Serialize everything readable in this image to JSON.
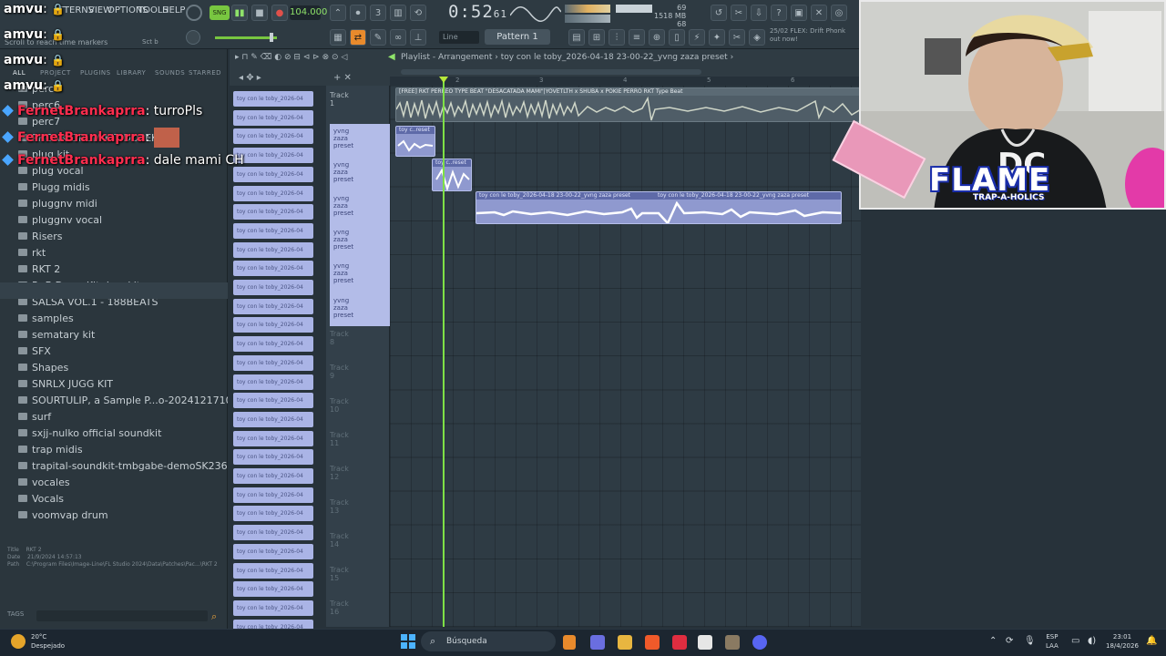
{
  "app": {
    "menu": [
      "TTERNS",
      "VIEW",
      "OPTIONS",
      "TOOLS",
      "HELP"
    ],
    "tempo": "104.000",
    "time": "0:52",
    "time_sub": "61",
    "cpu": "69",
    "memory": "1518 MB",
    "polyphony": "68",
    "pattern": "Pattern 1",
    "snap": "Line",
    "news_line1": "25/02  FLEX: Drift Phonk",
    "news_line2": "out now!",
    "hint": "Scroll to reach time markers",
    "hint_right": "Sct b"
  },
  "browser": {
    "tabs": [
      "ALL",
      "PROJECT",
      "PLUGINS",
      "LIBRARY",
      "SOUNDS",
      "STARRED"
    ],
    "items": [
      "perc6",
      "perc6",
      "perc7",
      "PHONK DRUM KIT DOPEKIT",
      "plug kit",
      "plug vocal",
      "Plugg midis",
      "pluggnv midi",
      "pluggnv vocal",
      "Risers",
      "rkt",
      "RKT  2",
      "RnB Drum Kit dopekit",
      "SALSA VOL.1 - 188BEATS",
      "samples",
      "sematary kit",
      "SFX",
      "Shapes",
      "SNRLX JUGG KIT",
      "SOURTULIP, a Sample P...o-20241217104503Z-001",
      "surf",
      "sxjj-nulko official soundkit",
      "trap midis",
      "trapital-soundkit-tmbgabe-demoSK236988",
      "vocales",
      "Vocals",
      "voomvap drum"
    ],
    "info_title_label": "Title",
    "info_title": "RKT  2",
    "info_date_label": "Date",
    "info_date": "21/9/2024 14:57:13",
    "info_path_label": "Path",
    "info_path": "C:\\Program Files\\Image-Line\\FL Studio 2024\\Data\\Patches\\Pac...\\RKT  2",
    "tags": "TAGS"
  },
  "cliplist": {
    "label": "toy con le toby_2026-04"
  },
  "playlist": {
    "title": "Playlist - Arrangement",
    "breadcrumb": "toy con le toby_2026-04-18 23-00-22_yvng zaza preset",
    "tracks": [
      "Track 1",
      "Track 8",
      "Track 9",
      "Track 10",
      "Track 11",
      "Track 12",
      "Track 13",
      "Track 14",
      "Track 15",
      "Track 16"
    ],
    "selected_track_label": "yvng zaza preset",
    "beat_clip_title": "[FREE] RKT PERREO TYPE BEAT \"DESACATADA MAMI\"|YOVETLTH x SHUBA x POKIE PERRO RKT Type Beat",
    "small_clip_1": "toy c..reset",
    "small_clip_2": "toy c..reset",
    "long_clip_a": "toy con le toby_2026-04-18 23-00-22_yvng zaza preset",
    "long_clip_b": "toy con le toby_2026-04-18 23-00-22_yvng zaza preset",
    "ruler_marks": [
      "2",
      "3",
      "4",
      "5",
      "6"
    ]
  },
  "chat": [
    {
      "user": "amvu",
      "text": ""
    },
    {
      "user": "amvu",
      "text": ""
    },
    {
      "user": "amvu",
      "text": ""
    },
    {
      "user": "amvu",
      "text": ""
    },
    {
      "user": "FernetBrankaprra",
      "text": "turroPls"
    },
    {
      "user": "FernetBrankaprra",
      "text": ""
    },
    {
      "user": "FernetBrankaprra",
      "text": "dale mami CH"
    }
  ],
  "overlay": {
    "brand": "FLAME",
    "brand_sub": "TRAP-A-HOLICS"
  },
  "taskbar": {
    "temperature": "20°C",
    "weather": "Despejado",
    "search": "Búsqueda",
    "lang1": "ESP",
    "lang2": "LAA",
    "clock_time": "23:01",
    "clock_date": "18/4/2026"
  }
}
